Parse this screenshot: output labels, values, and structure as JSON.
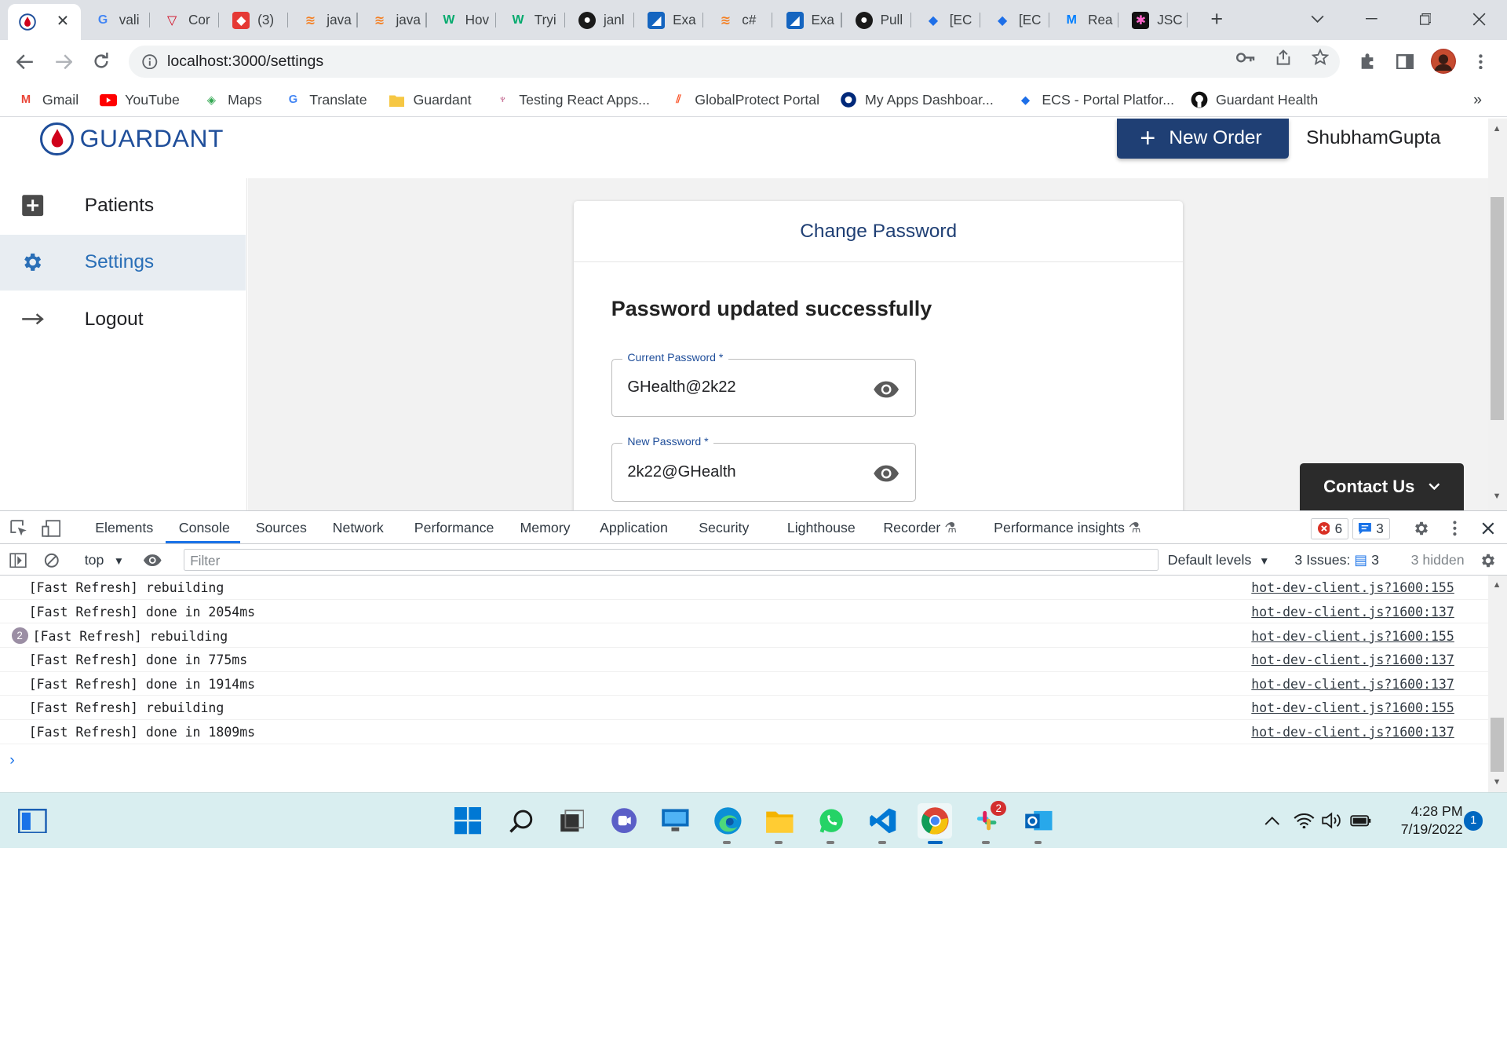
{
  "browser": {
    "tabs": [
      {
        "title": "",
        "icon": "guardant-icon",
        "active": true
      },
      {
        "title": "vali",
        "icon": "google-icon"
      },
      {
        "title": "Cor",
        "icon": "vercel-icon"
      },
      {
        "title": "(3)",
        "icon": "shield-icon"
      },
      {
        "title": "java",
        "icon": "stackoverflow-icon"
      },
      {
        "title": "java",
        "icon": "stackoverflow-icon"
      },
      {
        "title": "Hov",
        "icon": "w3schools-icon"
      },
      {
        "title": "Tryi",
        "icon": "w3schools-icon"
      },
      {
        "title": "janl",
        "icon": "github-icon"
      },
      {
        "title": "Exa",
        "icon": "app-icon"
      },
      {
        "title": "c#",
        "icon": "stackoverflow-icon"
      },
      {
        "title": "Exa",
        "icon": "app-icon"
      },
      {
        "title": "Pull",
        "icon": "github-icon"
      },
      {
        "title": "[EC",
        "icon": "diamond-icon"
      },
      {
        "title": "[EC",
        "icon": "diamond-icon"
      },
      {
        "title": "Rea",
        "icon": "mui-icon"
      },
      {
        "title": "JSC",
        "icon": "jsc-icon"
      }
    ],
    "url": "localhost:3000/settings",
    "bookmarks": [
      {
        "label": "Gmail",
        "icon": "gmail-icon"
      },
      {
        "label": "YouTube",
        "icon": "youtube-icon"
      },
      {
        "label": "Maps",
        "icon": "maps-icon"
      },
      {
        "label": "Translate",
        "icon": "translate-icon"
      },
      {
        "label": "Guardant",
        "icon": "folder-icon"
      },
      {
        "label": "Testing React Apps...",
        "icon": "bookmark-icon"
      },
      {
        "label": "GlobalProtect Portal",
        "icon": "globalprotect-icon"
      },
      {
        "label": "My Apps Dashboar...",
        "icon": "okta-icon"
      },
      {
        "label": "ECS - Portal Platfor...",
        "icon": "diamond-icon"
      },
      {
        "label": "Guardant Health",
        "icon": "github-icon"
      }
    ]
  },
  "app": {
    "brand": "GUARDANT",
    "new_order_label": "New Order",
    "username": "ShubhamGupta",
    "sidebar": [
      {
        "label": "Patients",
        "icon": "plus-square-icon"
      },
      {
        "label": "Settings",
        "icon": "gear-icon",
        "active": true
      },
      {
        "label": "Logout",
        "icon": "arrow-right-icon"
      }
    ],
    "card": {
      "title": "Change Password",
      "message": "Password updated successfully",
      "fields": [
        {
          "label": "Current Password *",
          "value": "GHealth@2k22"
        },
        {
          "label": "New Password *",
          "value": "2k22@GHealth"
        }
      ]
    },
    "contact_us": "Contact Us"
  },
  "devtools": {
    "tabs": [
      "Elements",
      "Console",
      "Sources",
      "Network",
      "Performance",
      "Memory",
      "Application",
      "Security",
      "Lighthouse",
      "Recorder",
      "Performance insights"
    ],
    "active_tab": "Console",
    "errors": "6",
    "messages": "3",
    "context": "top",
    "filter_placeholder": "Filter",
    "levels": "Default levels",
    "issues_label": "3 Issues:",
    "issues_count": "3",
    "hidden": "3 hidden",
    "logs": [
      {
        "count": "",
        "msg": "[Fast Refresh] rebuilding",
        "src": "hot-dev-client.js?1600:155"
      },
      {
        "count": "",
        "msg": "[Fast Refresh] done in 2054ms",
        "src": "hot-dev-client.js?1600:137"
      },
      {
        "count": "2",
        "msg": "[Fast Refresh] rebuilding",
        "src": "hot-dev-client.js?1600:155"
      },
      {
        "count": "",
        "msg": "[Fast Refresh] done in 775ms",
        "src": "hot-dev-client.js?1600:137"
      },
      {
        "count": "",
        "msg": "[Fast Refresh] done in 1914ms",
        "src": "hot-dev-client.js?1600:137"
      },
      {
        "count": "",
        "msg": "[Fast Refresh] rebuilding",
        "src": "hot-dev-client.js?1600:155"
      },
      {
        "count": "",
        "msg": "[Fast Refresh] done in 1809ms",
        "src": "hot-dev-client.js?1600:137"
      }
    ]
  },
  "taskbar": {
    "time": "4:28 PM",
    "date": "7/19/2022",
    "notifications": "1",
    "slack_badge": "2"
  },
  "colors": {
    "brand_blue": "#1f4e9a",
    "new_order_bg": "#1f3f74",
    "settings_active": "#2a6fb7",
    "contact_bg": "#2b2b2b"
  }
}
